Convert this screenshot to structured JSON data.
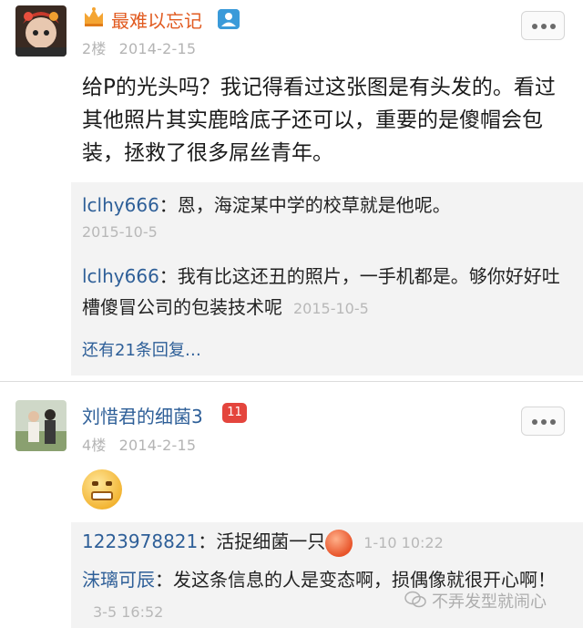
{
  "post1": {
    "username": "最难以忘记",
    "floor": "2楼",
    "date": "2014-2-15",
    "text": "给P的光头吗？我记得看过这张图是有头发的。看过其他照片其实鹿晗底子还可以，重要的是傻帽会包装，拯救了很多屌丝青年。",
    "replies": [
      {
        "user": "lclhy666",
        "sep": "：",
        "text": "恩，海淀某中学的校草就是他呢。",
        "time": "2015-10-5"
      },
      {
        "user": "lclhy666",
        "sep": "：",
        "text": "我有比这还丑的照片，一手机都是。够你好好吐槽傻冒公司的包装技术呢",
        "time": "2015-10-5"
      }
    ],
    "more_replies": "还有21条回复…"
  },
  "post2": {
    "username": "刘惜君的细菌3",
    "badge": "11",
    "floor": "4楼",
    "date": "2014-2-15",
    "replies": [
      {
        "user": "1223978821",
        "sep": "：",
        "text": "活捉细菌一只",
        "time": "1-10 10:22"
      },
      {
        "user": "沫璃可辰",
        "sep": "：",
        "text": "发这条信息的人是变态啊，损偶像就很开心啊！",
        "time": "3-5 16:52"
      }
    ]
  },
  "watermark": "不弄发型就闹心",
  "colors": {
    "vip_name": "#e15a1f",
    "name": "#2e5f98",
    "badge": "#e4453d",
    "meta": "#b4b4b4"
  },
  "icons": [
    "crown-icon",
    "id-verified-icon",
    "more-options-icon",
    "grimace-emoji-icon",
    "angry-emoji-icon",
    "wechat-icon"
  ]
}
